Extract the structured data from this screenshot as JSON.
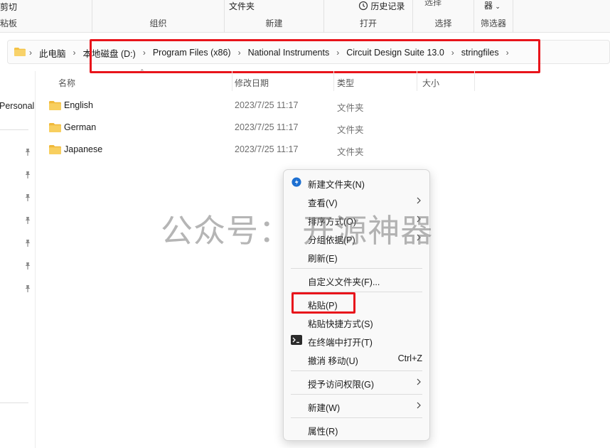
{
  "ribbon": {
    "cut_label": "剪切",
    "clipboard_label": "粘板",
    "folder_label": "文件夹",
    "history_label": "历史记录",
    "select_label": "选择",
    "filter_top": "器",
    "groups": {
      "organize": "组织",
      "new": "新建",
      "open": "打开",
      "select": "选择",
      "filter": "筛选器"
    }
  },
  "address": {
    "crumbs": [
      "此电脑",
      "本地磁盘 (D:)",
      "Program Files (x86)",
      "National Instruments",
      "Circuit Design Suite 13.0",
      "stringfiles"
    ]
  },
  "nav": {
    "personal_label": "Personal"
  },
  "columns": {
    "name": "名称",
    "modified": "修改日期",
    "type": "类型",
    "size": "大小"
  },
  "files": [
    {
      "name": "English",
      "modified": "2023/7/25 11:17",
      "type": "文件夹"
    },
    {
      "name": "German",
      "modified": "2023/7/25 11:17",
      "type": "文件夹"
    },
    {
      "name": "Japanese",
      "modified": "2023/7/25 11:17",
      "type": "文件夹"
    }
  ],
  "watermark": "公众号：  开源神器",
  "context_menu": {
    "new_folder": "新建文件夹(N)",
    "view": "查看(V)",
    "sort": "排序方式(O)",
    "group": "分组依据(P)",
    "refresh": "刷新(E)",
    "customize": "自定义文件夹(F)...",
    "paste": "粘贴(P)",
    "paste_shortcut": "粘贴快捷方式(S)",
    "open_terminal": "在终端中打开(T)",
    "undo": "撤消 移动(U)",
    "undo_shortcut": "Ctrl+Z",
    "grant_access": "授予访问权限(G)",
    "new": "新建(W)",
    "properties": "属性(R)"
  },
  "colors": {
    "highlight_red": "#e8141b",
    "folder_yellow": "#f4c244",
    "accent_blue": "#1c6fd1"
  }
}
